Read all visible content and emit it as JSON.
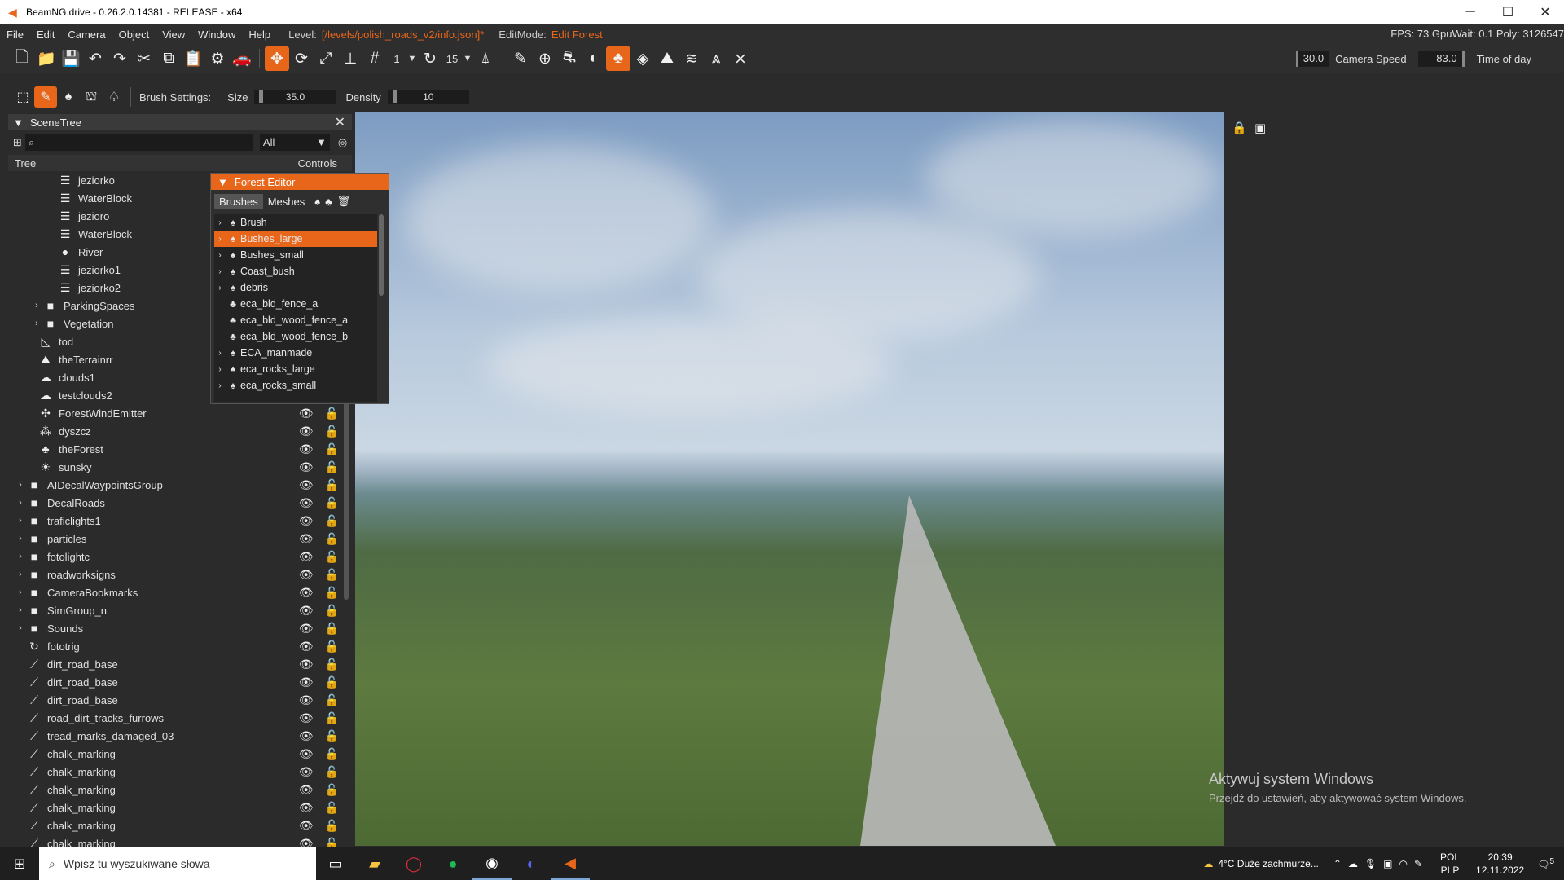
{
  "titlebar": {
    "title": "BeamNG.drive - 0.26.2.0.14381 - RELEASE - x64",
    "minimize": "─",
    "maximize": "☐",
    "close": "✕"
  },
  "menubar": {
    "items": [
      "File",
      "Edit",
      "Camera",
      "Object",
      "View",
      "Window",
      "Help"
    ],
    "level_label": "Level:",
    "level_value": "[/levels/polish_roads_v2/info.json]*",
    "editmode_label": "EditMode:",
    "editmode_value": "Edit Forest",
    "stats": "FPS: 73  GpuWait: 0.1  Poly: 3126547"
  },
  "toolbar": {
    "grid_value": "1",
    "snap_value": "15",
    "camera_value": "30.0",
    "camera_speed_label": "Camera Speed",
    "camera_speed_value": "83.0",
    "time_of_day_label": "Time of day"
  },
  "brush": {
    "settings_label": "Brush Settings:",
    "size_label": "Size",
    "size_value": "35.0",
    "density_label": "Density",
    "density_value": "10"
  },
  "scenetree": {
    "title": "SceneTree",
    "filter_value": "All",
    "col_tree": "Tree",
    "col_controls": "Controls",
    "rows": [
      {
        "label": "jeziorko",
        "icon": "☰",
        "indent": 46,
        "arrow": ""
      },
      {
        "label": "WaterBlock",
        "icon": "☰",
        "indent": 46,
        "arrow": ""
      },
      {
        "label": "jezioro",
        "icon": "☰",
        "indent": 46,
        "arrow": ""
      },
      {
        "label": "WaterBlock",
        "icon": "☰",
        "indent": 46,
        "arrow": ""
      },
      {
        "label": "River",
        "icon": "●",
        "indent": 46,
        "arrow": ""
      },
      {
        "label": "jeziorko1",
        "icon": "☰",
        "indent": 46,
        "arrow": ""
      },
      {
        "label": "jeziorko2",
        "icon": "☰",
        "indent": 46,
        "arrow": ""
      },
      {
        "label": "ParkingSpaces",
        "icon": "■",
        "indent": 28,
        "arrow": "›"
      },
      {
        "label": "Vegetation",
        "icon": "■",
        "indent": 28,
        "arrow": "›"
      },
      {
        "label": "tod",
        "icon": "◺",
        "indent": 22,
        "arrow": ""
      },
      {
        "label": "theTerrainrr",
        "icon": "⛰",
        "indent": 22,
        "arrow": ""
      },
      {
        "label": "clouds1",
        "icon": "☁",
        "indent": 22,
        "arrow": ""
      },
      {
        "label": "testclouds2",
        "icon": "☁",
        "indent": 22,
        "arrow": ""
      },
      {
        "label": "ForestWindEmitter",
        "icon": "✣",
        "indent": 22,
        "arrow": "",
        "ctrl": true
      },
      {
        "label": "dyszcz",
        "icon": "⁂",
        "indent": 22,
        "arrow": "",
        "ctrl": true
      },
      {
        "label": "theForest",
        "icon": "♣",
        "indent": 22,
        "arrow": "",
        "ctrl": true
      },
      {
        "label": "sunsky",
        "icon": "☀",
        "indent": 22,
        "arrow": "",
        "ctrl": true
      },
      {
        "label": "AIDecalWaypointsGroup",
        "icon": "■",
        "indent": 8,
        "arrow": "›",
        "ctrl": true
      },
      {
        "label": "DecalRoads",
        "icon": "■",
        "indent": 8,
        "arrow": "›",
        "ctrl": true
      },
      {
        "label": "traficlights1",
        "icon": "■",
        "indent": 8,
        "arrow": "›",
        "ctrl": true
      },
      {
        "label": "particles",
        "icon": "■",
        "indent": 8,
        "arrow": "›",
        "ctrl": true
      },
      {
        "label": "fotolightc",
        "icon": "■",
        "indent": 8,
        "arrow": "›",
        "ctrl": true
      },
      {
        "label": "roadworksigns",
        "icon": "■",
        "indent": 8,
        "arrow": "›",
        "ctrl": true
      },
      {
        "label": "CameraBookmarks",
        "icon": "■",
        "indent": 8,
        "arrow": "›",
        "ctrl": true
      },
      {
        "label": "SimGroup_n",
        "icon": "■",
        "indent": 8,
        "arrow": "›",
        "ctrl": true
      },
      {
        "label": "Sounds",
        "icon": "■",
        "indent": 8,
        "arrow": "›",
        "ctrl": true
      },
      {
        "label": "fototrig",
        "icon": "↻",
        "indent": 8,
        "arrow": "",
        "ctrl": true
      },
      {
        "label": "dirt_road_base",
        "icon": "⟋",
        "indent": 8,
        "arrow": "",
        "ctrl": true
      },
      {
        "label": "dirt_road_base",
        "icon": "⟋",
        "indent": 8,
        "arrow": "",
        "ctrl": true
      },
      {
        "label": "dirt_road_base",
        "icon": "⟋",
        "indent": 8,
        "arrow": "",
        "ctrl": true
      },
      {
        "label": "road_dirt_tracks_furrows",
        "icon": "⟋",
        "indent": 8,
        "arrow": "",
        "ctrl": true
      },
      {
        "label": "tread_marks_damaged_03",
        "icon": "⟋",
        "indent": 8,
        "arrow": "",
        "ctrl": true
      },
      {
        "label": "chalk_marking",
        "icon": "⟋",
        "indent": 8,
        "arrow": "",
        "ctrl": true
      },
      {
        "label": "chalk_marking",
        "icon": "⟋",
        "indent": 8,
        "arrow": "",
        "ctrl": true
      },
      {
        "label": "chalk_marking",
        "icon": "⟋",
        "indent": 8,
        "arrow": "",
        "ctrl": true
      },
      {
        "label": "chalk_marking",
        "icon": "⟋",
        "indent": 8,
        "arrow": "",
        "ctrl": true
      },
      {
        "label": "chalk_marking",
        "icon": "⟋",
        "indent": 8,
        "arrow": "",
        "ctrl": true
      },
      {
        "label": "chalk_marking",
        "icon": "⟋",
        "indent": 8,
        "arrow": "",
        "ctrl": true
      }
    ]
  },
  "forest_editor": {
    "title": "Forest Editor",
    "tab_brushes": "Brushes",
    "tab_meshes": "Meshes",
    "items": [
      {
        "label": "Brush",
        "arrow": "›",
        "icon": "♠",
        "selected": false
      },
      {
        "label": "Bushes_large",
        "arrow": "›",
        "icon": "♠",
        "selected": true
      },
      {
        "label": "Bushes_small",
        "arrow": "›",
        "icon": "♠",
        "selected": false
      },
      {
        "label": "Coast_bush",
        "arrow": "›",
        "icon": "♠",
        "selected": false
      },
      {
        "label": "debris",
        "arrow": "›",
        "icon": "♠",
        "selected": false
      },
      {
        "label": "eca_bld_fence_a",
        "arrow": "",
        "icon": "♣",
        "selected": false
      },
      {
        "label": "eca_bld_wood_fence_a",
        "arrow": "",
        "icon": "♣",
        "selected": false
      },
      {
        "label": "eca_bld_wood_fence_b",
        "arrow": "",
        "icon": "♣",
        "selected": false
      },
      {
        "label": "ECA_manmade",
        "arrow": "›",
        "icon": "♠",
        "selected": false
      },
      {
        "label": "eca_rocks_large",
        "arrow": "›",
        "icon": "♠",
        "selected": false
      },
      {
        "label": "eca_rocks_small",
        "arrow": "›",
        "icon": "♠",
        "selected": false
      }
    ]
  },
  "watermark": {
    "line1": "Aktywuj system Windows",
    "line2": "Przejdź do ustawień, aby aktywować system Windows."
  },
  "taskbar": {
    "search_placeholder": "Wpisz tu wyszukiwane słowa",
    "weather": "4°C  Duże zachmurze...",
    "lang1": "POL",
    "lang2": "PLP",
    "time": "20:39",
    "date": "12.11.2022",
    "notif": "5"
  },
  "colors": {
    "accent": "#e8661a"
  }
}
